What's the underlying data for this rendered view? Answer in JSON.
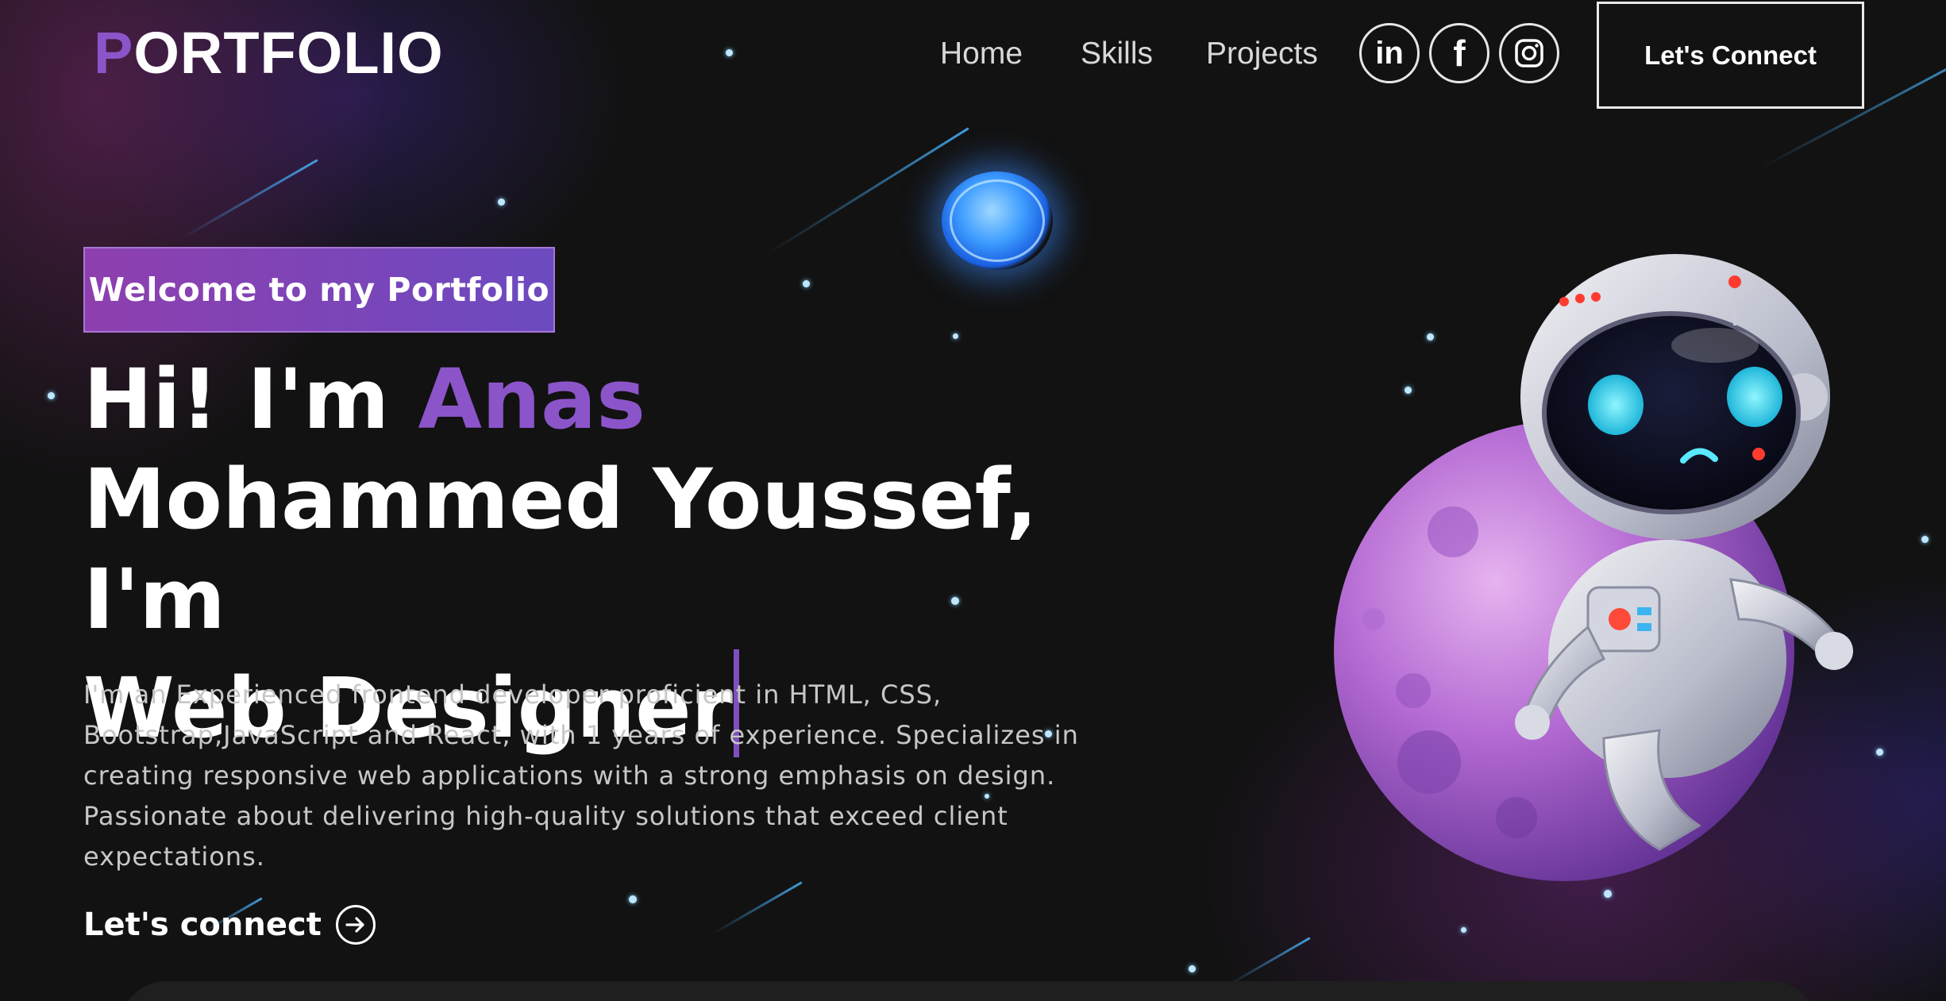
{
  "nav": {
    "logo_accent": "P",
    "logo_rest": "ORTFOLIO",
    "links": [
      "Home",
      "Skills",
      "Projects"
    ],
    "social": [
      {
        "icon": "linkedin-icon",
        "label": "in"
      },
      {
        "icon": "facebook-icon",
        "label": "f"
      },
      {
        "icon": "instagram-icon",
        "label": ""
      }
    ],
    "connect_label": "Let's Connect"
  },
  "hero": {
    "tagline": "Welcome to my Portfolio",
    "greeting": "Hi! I'm ",
    "name": "Anas",
    "line2": "Mohammed Youssef, I'm",
    "role": "Web Designer",
    "description": "I'm an Experienced frontend developer proficient in HTML, CSS, Bootstrap,JavaScript and React, with 1 years of experience. Specializes in creating responsive web applications with a strong emphasis on design. Passionate about delivering high-quality solutions that exceed client expectations.",
    "cta_label": "Let's connect",
    "cta_icon": "arrow-right-circle-icon"
  },
  "colors": {
    "accent": "#8b55c9",
    "background": "#121212",
    "tagline_gradient_start": "#8e3fae",
    "tagline_gradient_end": "#6c4ac0",
    "text_muted": "#c7c7c7"
  }
}
